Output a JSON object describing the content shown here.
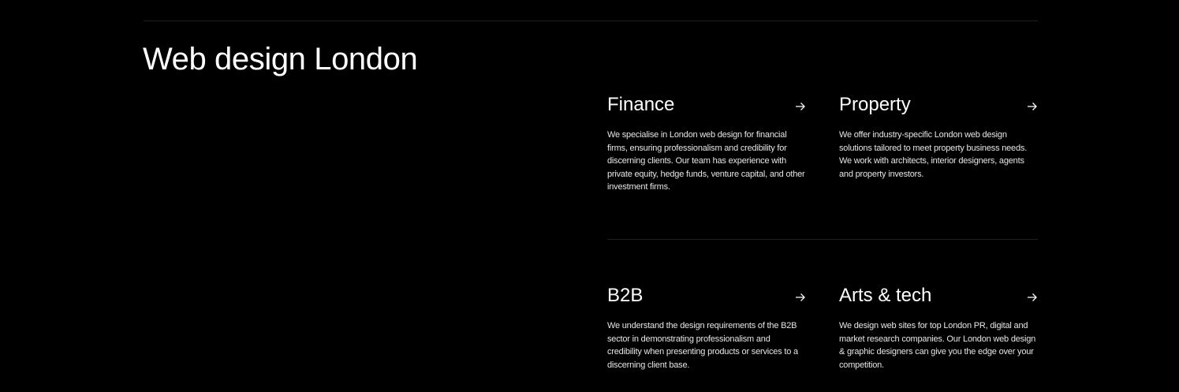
{
  "section": {
    "title": "Web design London"
  },
  "cards": [
    {
      "title": "Finance",
      "description": "We specialise in London web design for financial firms, ensuring professionalism and credibility for discerning clients. Our team has experience with private equity, hedge funds, venture capital, and other investment firms."
    },
    {
      "title": "Property",
      "description": "We offer industry-specific London web design solutions tailored to meet property business needs. We work with architects, interior designers, agents and property investors."
    },
    {
      "title": "B2B",
      "description": "We understand the design requirements of the B2B sector in demonstrating professionalism and credibility when presenting products or services to a discerning client base."
    },
    {
      "title": "Arts & tech",
      "description": "We design web sites for top London PR, digital and market research companies. Our London web design & graphic designers can give you the edge over your competition."
    }
  ],
  "icons": {
    "card_link": "arrow-right-icon"
  },
  "colors": {
    "background": "#000000",
    "text": "#ffffff",
    "divider": "#1f1f1f"
  }
}
